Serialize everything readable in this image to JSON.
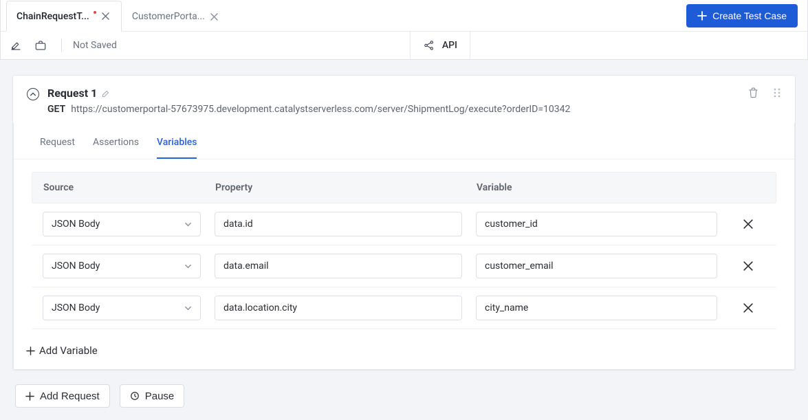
{
  "header": {
    "tabs": [
      {
        "label": "ChainRequestT...",
        "dirty": true
      },
      {
        "label": "CustomerPorta...",
        "dirty": false
      }
    ],
    "create_button": "Create Test Case",
    "status_text": "Not Saved",
    "api_label": "API"
  },
  "request": {
    "title": "Request 1",
    "method": "GET",
    "url": "https://customerportal-57673975.development.catalystserverless.com/server/ShipmentLog/execute?orderID=10342",
    "subtabs": {
      "request": "Request",
      "assertions": "Assertions",
      "variables": "Variables"
    },
    "columns": {
      "source": "Source",
      "property": "Property",
      "variable": "Variable"
    },
    "rows": [
      {
        "source": "JSON Body",
        "property": "data.id",
        "variable": "customer_id"
      },
      {
        "source": "JSON Body",
        "property": "data.email",
        "variable": "customer_email"
      },
      {
        "source": "JSON Body",
        "property": "data.location.city",
        "variable": "city_name"
      }
    ],
    "add_variable_label": "Add Variable"
  },
  "footer": {
    "add_request_label": "Add Request",
    "pause_label": "Pause"
  }
}
